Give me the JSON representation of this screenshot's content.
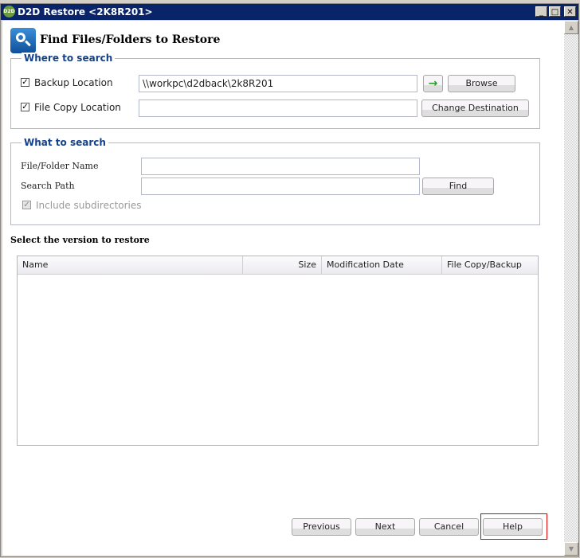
{
  "window": {
    "title": "D2D Restore <2K8R201>",
    "logo": "D2D",
    "controls": {
      "minimize": "_",
      "maximize": "□",
      "close": "✕"
    }
  },
  "page_title": "Find Files/Folders to Restore",
  "where": {
    "legend": "Where to search",
    "backup_label": "Backup Location",
    "backup_checked": true,
    "backup_value": "\\\\workpc\\d2dback\\2k8R201",
    "filecopy_label": "File Copy Location",
    "filecopy_checked": true,
    "filecopy_value": "",
    "browse": "Browse",
    "change_destination": "Change Destination",
    "go_icon": "→"
  },
  "what": {
    "legend": "What to search",
    "name_label": "File/Folder Name",
    "name_value": "",
    "path_label": "Search Path",
    "path_value": "",
    "find": "Find",
    "include_label": "Include subdirectories",
    "include_checked": true
  },
  "versions": {
    "title": "Select the version to restore",
    "columns": [
      "Name",
      "Size",
      "Modification Date",
      "File Copy/Backup"
    ],
    "rows": []
  },
  "footer": {
    "previous": "Previous",
    "next": "Next",
    "cancel": "Cancel",
    "help": "Help"
  },
  "colors": {
    "titlebar": "#0a246a",
    "legend": "#15428b",
    "highlight": "#e00000"
  }
}
